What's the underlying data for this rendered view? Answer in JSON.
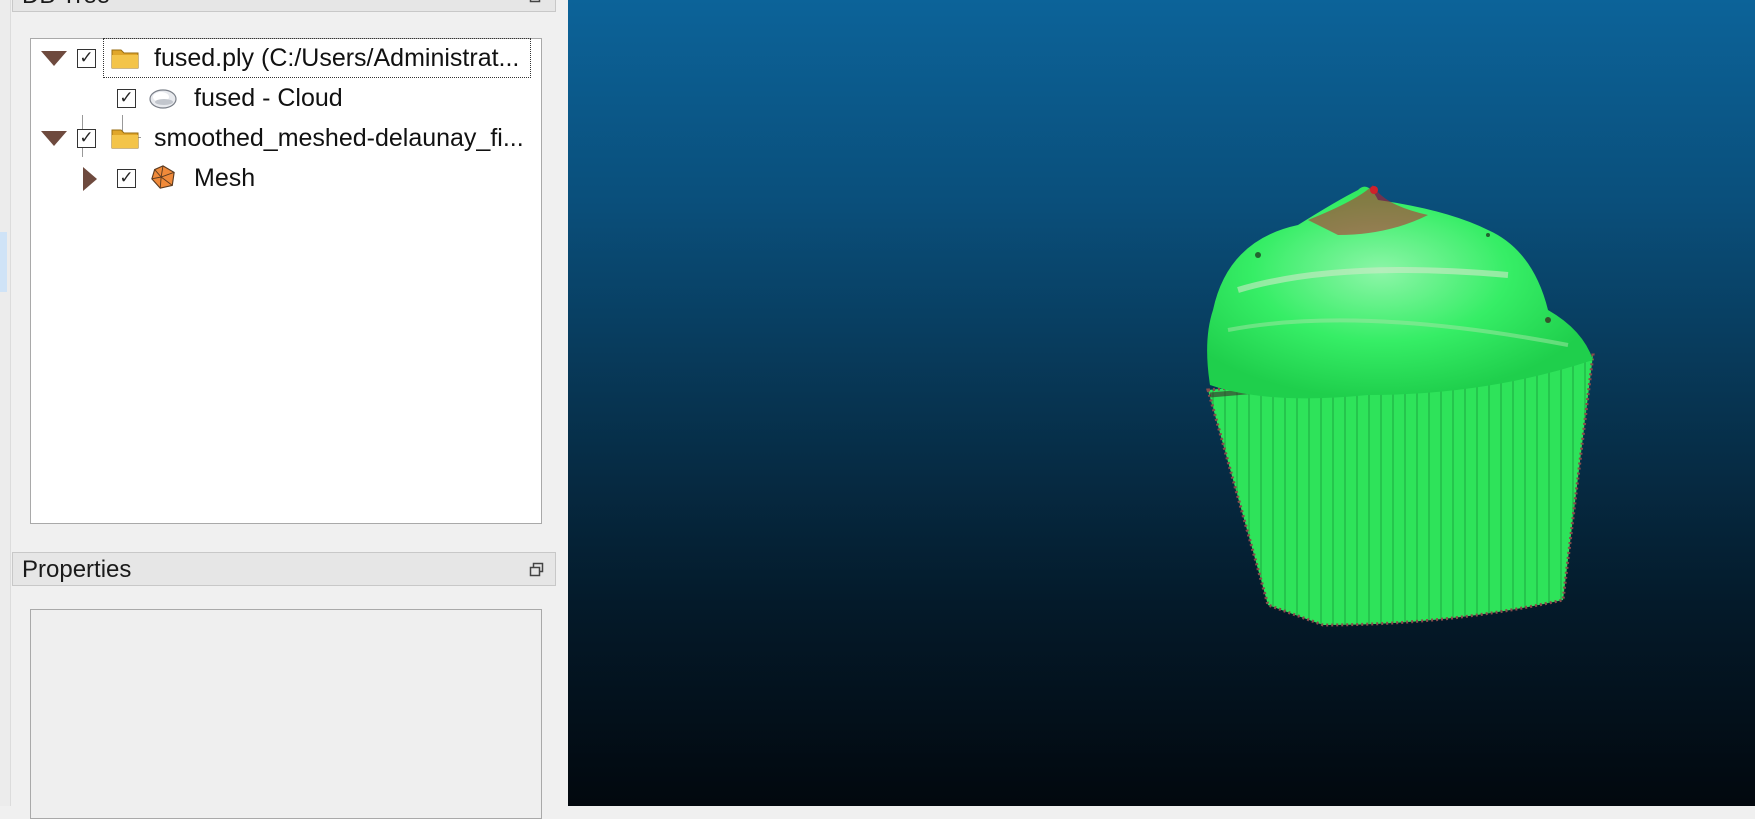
{
  "db_tree": {
    "title": "DB Tree",
    "items": [
      {
        "label": "fused.ply (C:/Users/Administrat...",
        "checked": true,
        "expanded": true,
        "icon": "folder-icon"
      },
      {
        "label": "fused - Cloud",
        "checked": true,
        "icon": "point-cloud-icon"
      },
      {
        "label": "smoothed_meshed-delaunay_fi...",
        "checked": true,
        "expanded": true,
        "icon": "folder-icon"
      },
      {
        "label": "Mesh",
        "checked": true,
        "expanded": false,
        "icon": "mesh-icon"
      }
    ]
  },
  "properties": {
    "title": "Properties"
  },
  "viewport": {
    "background_top": "#0c6399",
    "background_bottom": "#02080e",
    "object": "cupcake point cloud",
    "object_color": "#2ef05a"
  }
}
